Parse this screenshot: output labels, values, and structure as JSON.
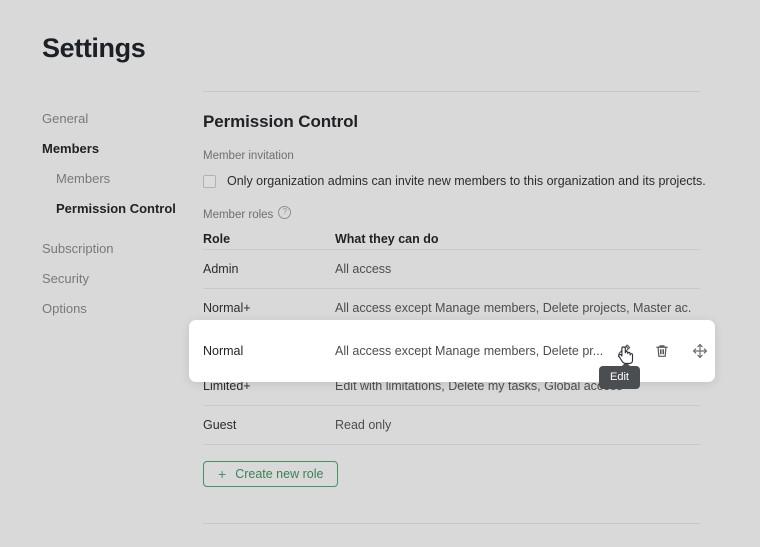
{
  "page": {
    "title": "Settings",
    "background_color": "#d9d9d9",
    "accent_green": "#4b8f64"
  },
  "sidebar": {
    "items": [
      {
        "label": "General",
        "level": 0,
        "active": false
      },
      {
        "label": "Members",
        "level": 0,
        "active": true
      },
      {
        "label": "Members",
        "level": 1,
        "active": false
      },
      {
        "label": "Permission Control",
        "level": 1,
        "active": true
      },
      {
        "label": "Subscription",
        "level": 0,
        "active": false
      },
      {
        "label": "Security",
        "level": 0,
        "active": false
      },
      {
        "label": "Options",
        "level": 0,
        "active": false
      }
    ]
  },
  "main": {
    "section_title": "Permission Control",
    "member_invitation": {
      "label": "Member invitation",
      "checkbox_label": "Only organization admins can invite new members to this organization and its projects.",
      "checked": false
    },
    "member_roles": {
      "label": "Member roles",
      "help_icon": "question-circle-icon",
      "columns": {
        "role": "Role",
        "description": "What they can do"
      },
      "rows": [
        {
          "role": "Admin",
          "description": "All access",
          "hovered": false
        },
        {
          "role": "Normal+",
          "description": "All access except Manage members, Delete projects, Master ac.",
          "hovered": false
        },
        {
          "role": "Normal",
          "description": "All access except Manage members, Delete pr...",
          "hovered": true
        },
        {
          "role": "Limited+",
          "description": "Edit with limitations, Delete my tasks, Global access",
          "hovered": false
        },
        {
          "role": "Guest",
          "description": "Read only",
          "hovered": false
        }
      ],
      "row_actions": [
        {
          "name": "edit",
          "icon": "pencil-icon"
        },
        {
          "name": "delete",
          "icon": "trash-icon"
        },
        {
          "name": "reorder",
          "icon": "move-arrows-icon"
        }
      ],
      "tooltip": "Edit"
    },
    "create_button": {
      "label": "Create new role",
      "icon": "plus-icon"
    }
  }
}
